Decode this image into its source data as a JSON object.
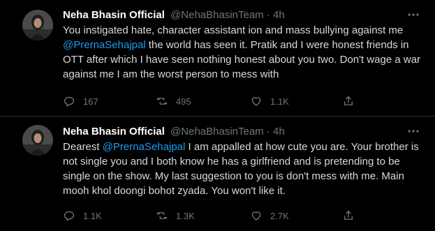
{
  "tweets": [
    {
      "name": "Neha Bhasin Official",
      "handle": "@NehaBhasinTeam",
      "dot": "·",
      "time": "4h",
      "text": {
        "p1": "You instigated hate, character assistant ion and mass bullying against me ",
        "mention": "@PrernaSehajpal",
        "p2": " the world has seen it. Pratik and I were honest friends in OTT after which I have seen nothing honest about you two. Don't wage a war against me I am the worst person to mess with"
      },
      "replies": "167",
      "retweets": "495",
      "likes": "1.1K",
      "icons": {
        "reply": "reply-icon",
        "retweet": "retweet-icon",
        "like": "heart-icon",
        "share": "share-icon",
        "more": "more-icon"
      }
    },
    {
      "name": "Neha Bhasin Official",
      "handle": "@NehaBhasinTeam",
      "dot": "·",
      "time": "4h",
      "text": {
        "p1": "Dearest ",
        "mention": "@PrernaSehajpal",
        "p2": " I am appalled at how cute you are. Your brother is not single you and I both know he has a girlfriend and is pretending to be single on the show. My last suggestion to you is don't mess with me. Main mooh khol doongi bohot zyada. You won't like it."
      },
      "replies": "1.1K",
      "retweets": "1.3K",
      "likes": "2.7K",
      "icons": {
        "reply": "reply-icon",
        "retweet": "retweet-icon",
        "like": "heart-icon",
        "share": "share-icon",
        "more": "more-icon"
      }
    }
  ],
  "colors": {
    "background": "#000000",
    "text": "#d9d9d9",
    "muted": "#6e767d",
    "link": "#1d9bf0",
    "divider": "#2f3336"
  }
}
